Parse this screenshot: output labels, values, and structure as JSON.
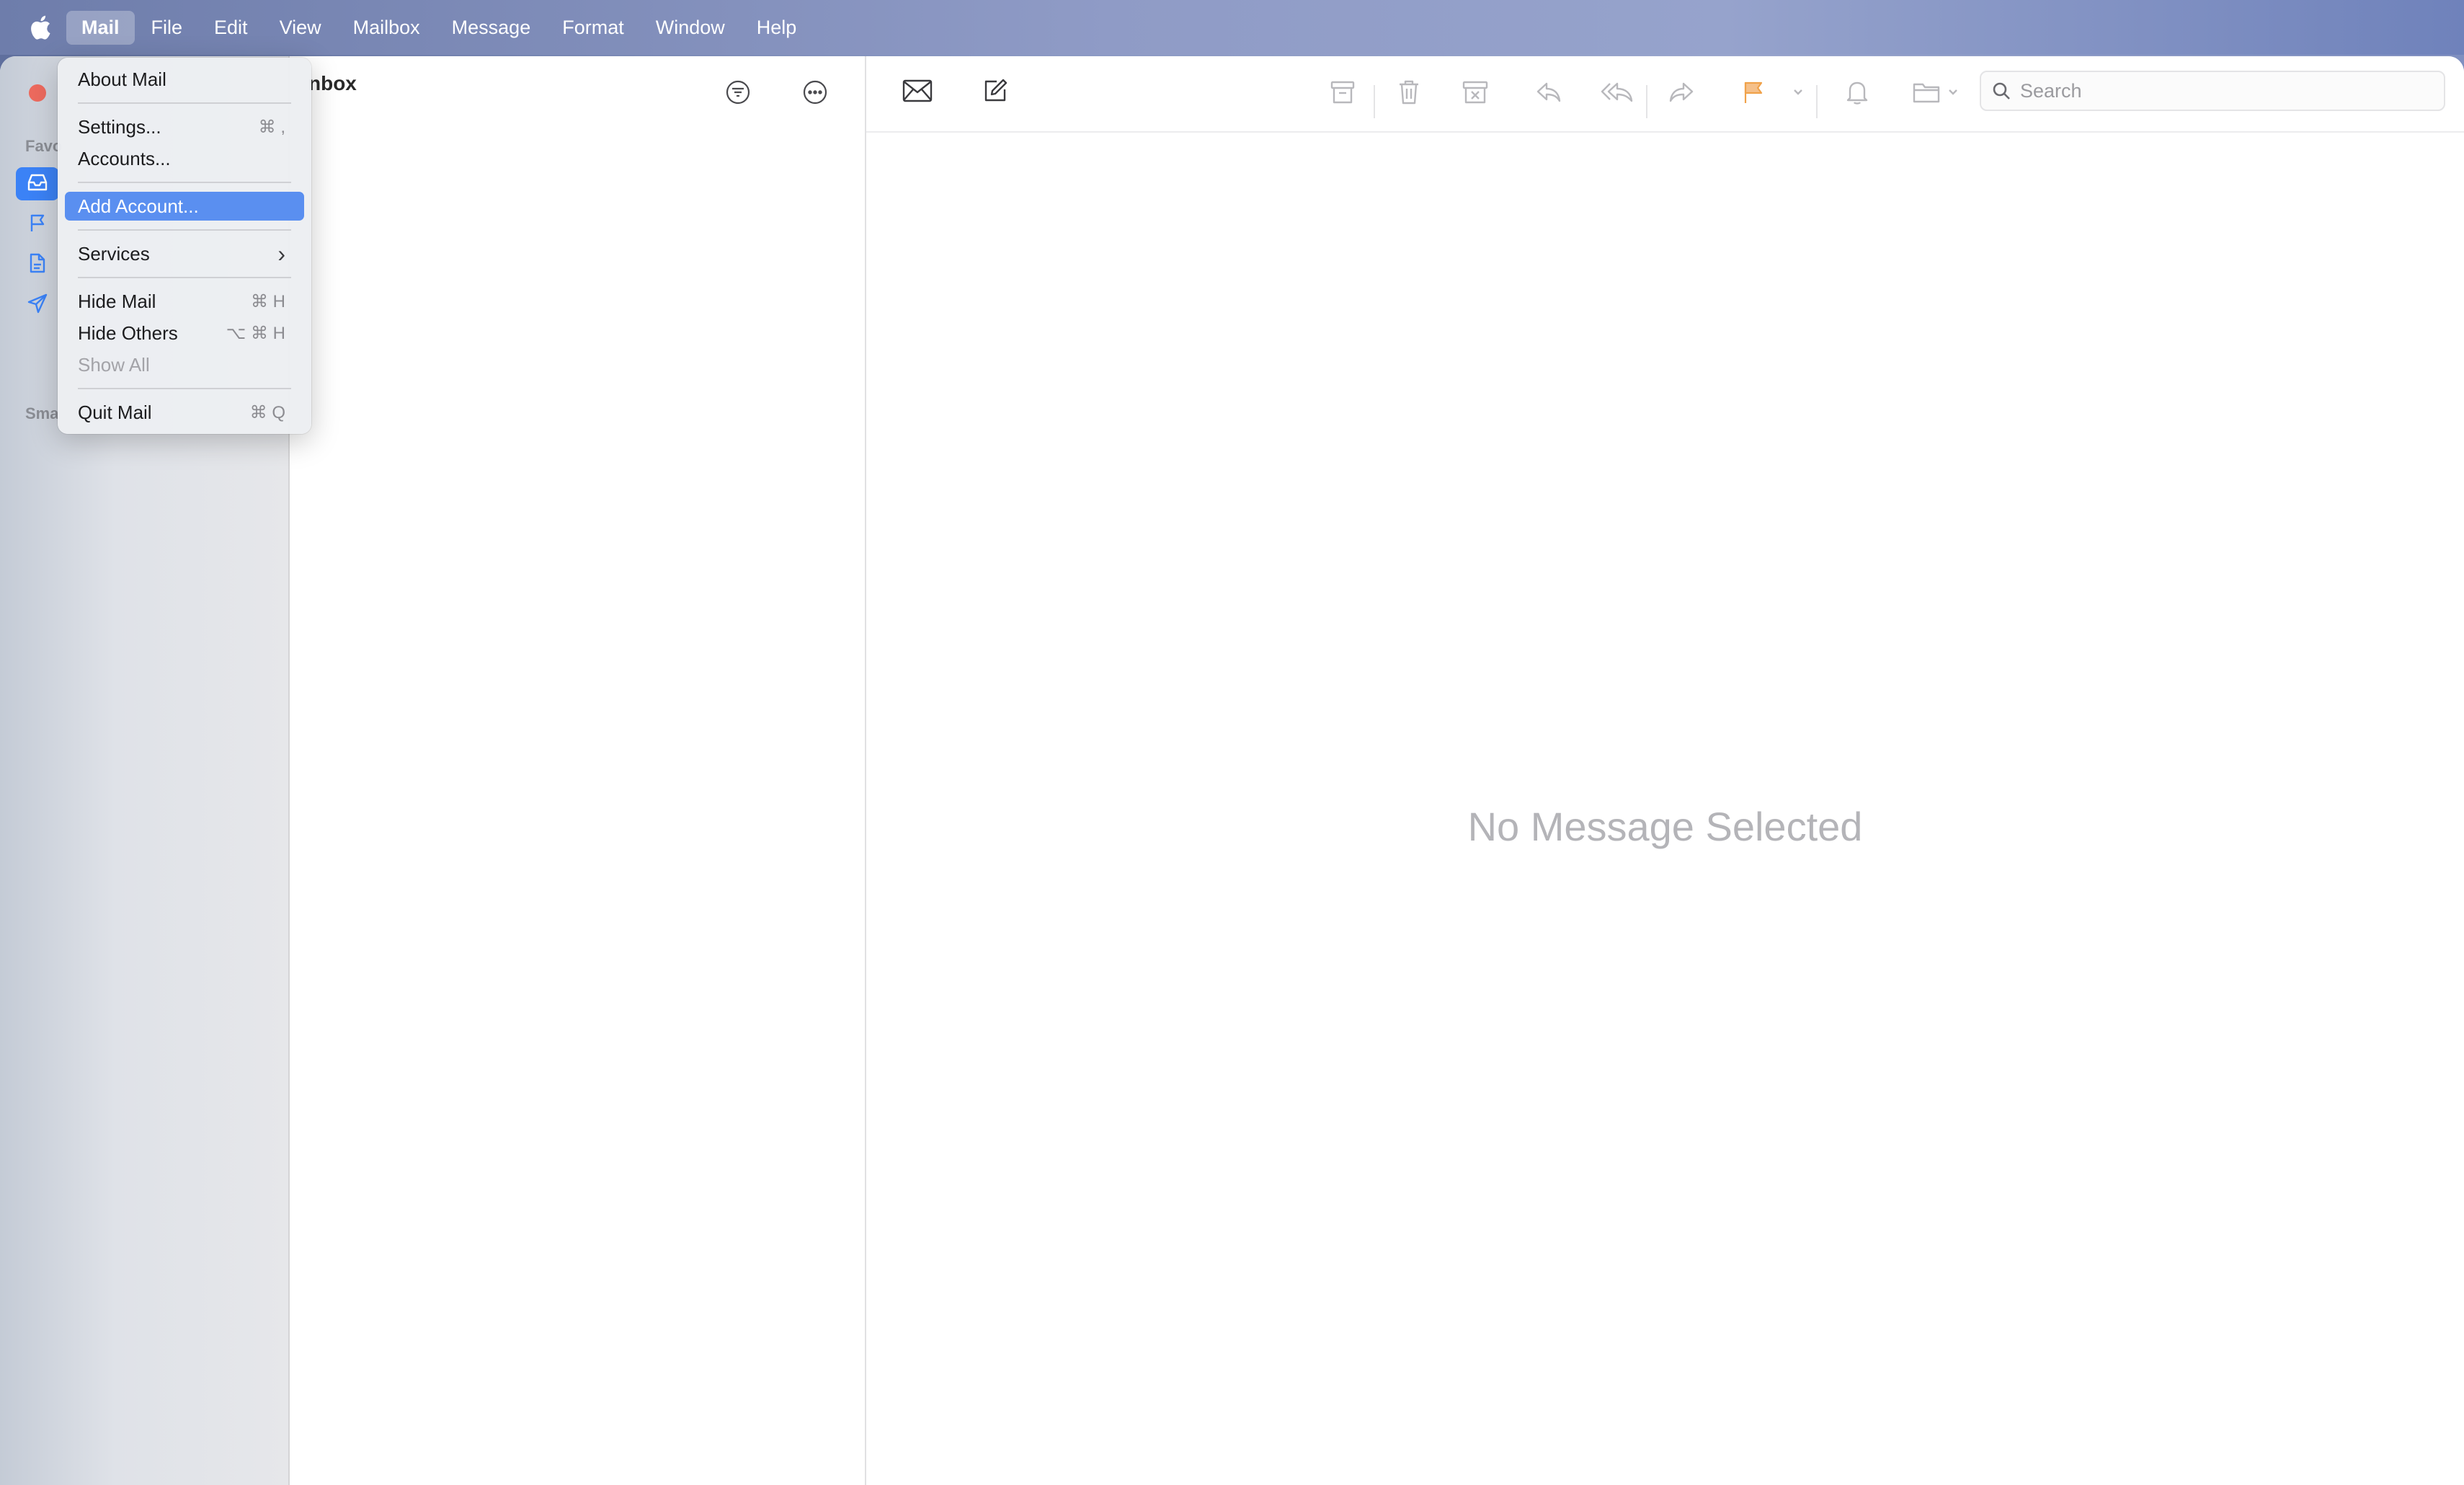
{
  "menubar": {
    "items": [
      {
        "label": "Mail",
        "active": true
      },
      {
        "label": "File"
      },
      {
        "label": "Edit"
      },
      {
        "label": "View"
      },
      {
        "label": "Mailbox"
      },
      {
        "label": "Message"
      },
      {
        "label": "Format"
      },
      {
        "label": "Window"
      },
      {
        "label": "Help"
      }
    ]
  },
  "mail_menu": {
    "items": [
      {
        "label": "About Mail",
        "shortcut": ""
      },
      {
        "label": "Settings...",
        "shortcut": "⌘ ,"
      },
      {
        "label": "Accounts...",
        "shortcut": ""
      },
      {
        "label": "Add Account...",
        "shortcut": "",
        "highlighted": true
      },
      {
        "label": "Services",
        "shortcut": "›"
      },
      {
        "label": "Hide Mail",
        "shortcut": "⌘ H"
      },
      {
        "label": "Hide Others",
        "shortcut": "⌥ ⌘ H"
      },
      {
        "label": "Show All",
        "shortcut": "",
        "disabled": true
      },
      {
        "label": "Quit Mail",
        "shortcut": "⌘ Q"
      }
    ]
  },
  "sidebar": {
    "favorites_label": "Favo",
    "smart_label": "Sma"
  },
  "message_list": {
    "title": "nbox"
  },
  "viewer": {
    "search_placeholder": "Search",
    "empty_state": "No Message Selected"
  },
  "colors": {
    "accent": "#3b82f6",
    "menu_highlight": "#5a8ff0",
    "flag": "#f0a24a",
    "close_button": "#ed6a5e"
  },
  "icons": [
    "apple-logo-icon",
    "inbox-icon",
    "flag-icon",
    "document-icon",
    "paper-plane-icon",
    "filter-icon",
    "more-icon",
    "envelope-icon",
    "compose-icon",
    "archive-icon",
    "trash-icon",
    "junk-icon",
    "reply-icon",
    "reply-all-icon",
    "forward-icon",
    "flag-icon",
    "bell-icon",
    "folder-icon",
    "search-icon"
  ]
}
